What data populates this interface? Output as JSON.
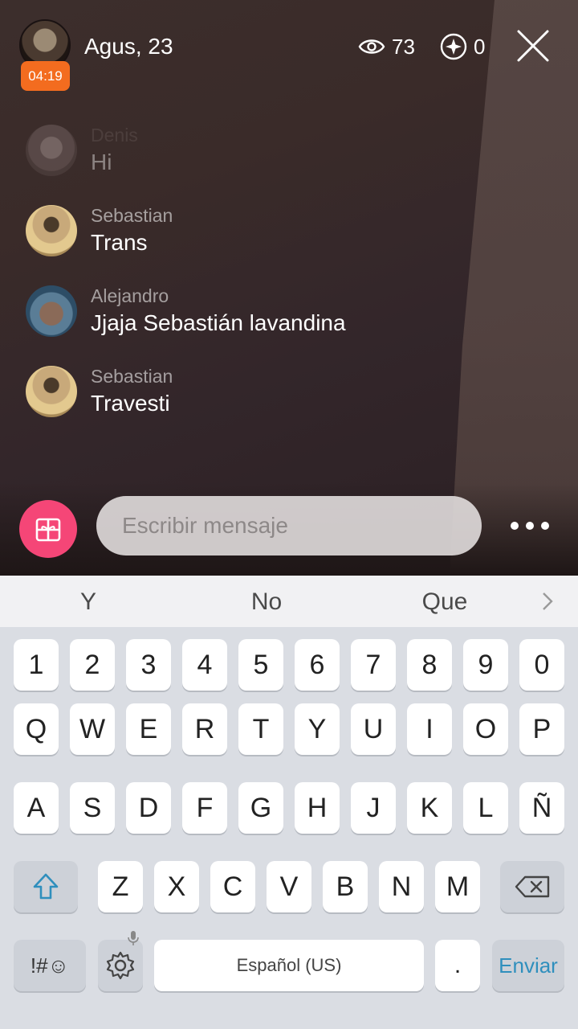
{
  "header": {
    "host_name": "Agus, 23",
    "timer": "04:19",
    "viewers_count": "73",
    "stars_count": "0",
    "icons": {
      "viewers": "eye-icon",
      "stars": "sparkle-icon",
      "close": "close-icon"
    }
  },
  "chat": [
    {
      "author": "Denis",
      "text": "Hi"
    },
    {
      "author": "Sebastian",
      "text": "Trans"
    },
    {
      "author": "Alejandro",
      "text": "Jjaja Sebastián lavandina"
    },
    {
      "author": "Sebastian",
      "text": "Travesti"
    }
  ],
  "composer": {
    "placeholder": "Escribir mensaje",
    "gift_icon": "gift-icon",
    "more_icon": "more-dots-icon"
  },
  "keyboard": {
    "suggestions": [
      "Y",
      "No",
      "Que"
    ],
    "row_numbers": [
      "1",
      "2",
      "3",
      "4",
      "5",
      "6",
      "7",
      "8",
      "9",
      "0"
    ],
    "row_1": [
      "Q",
      "W",
      "E",
      "R",
      "T",
      "Y",
      "U",
      "I",
      "O",
      "P"
    ],
    "row_2": [
      "A",
      "S",
      "D",
      "F",
      "G",
      "H",
      "J",
      "K",
      "L",
      "Ñ"
    ],
    "row_3": [
      "Z",
      "X",
      "C",
      "V",
      "B",
      "N",
      "M"
    ],
    "sym_label": "!#☺",
    "space_label": "Español (US)",
    "period_label": ".",
    "enter_label": "Enviar",
    "accent_color": "#2f8fbd"
  },
  "colors": {
    "timer_badge": "#f36c1f",
    "gift_button": "#f54677"
  }
}
